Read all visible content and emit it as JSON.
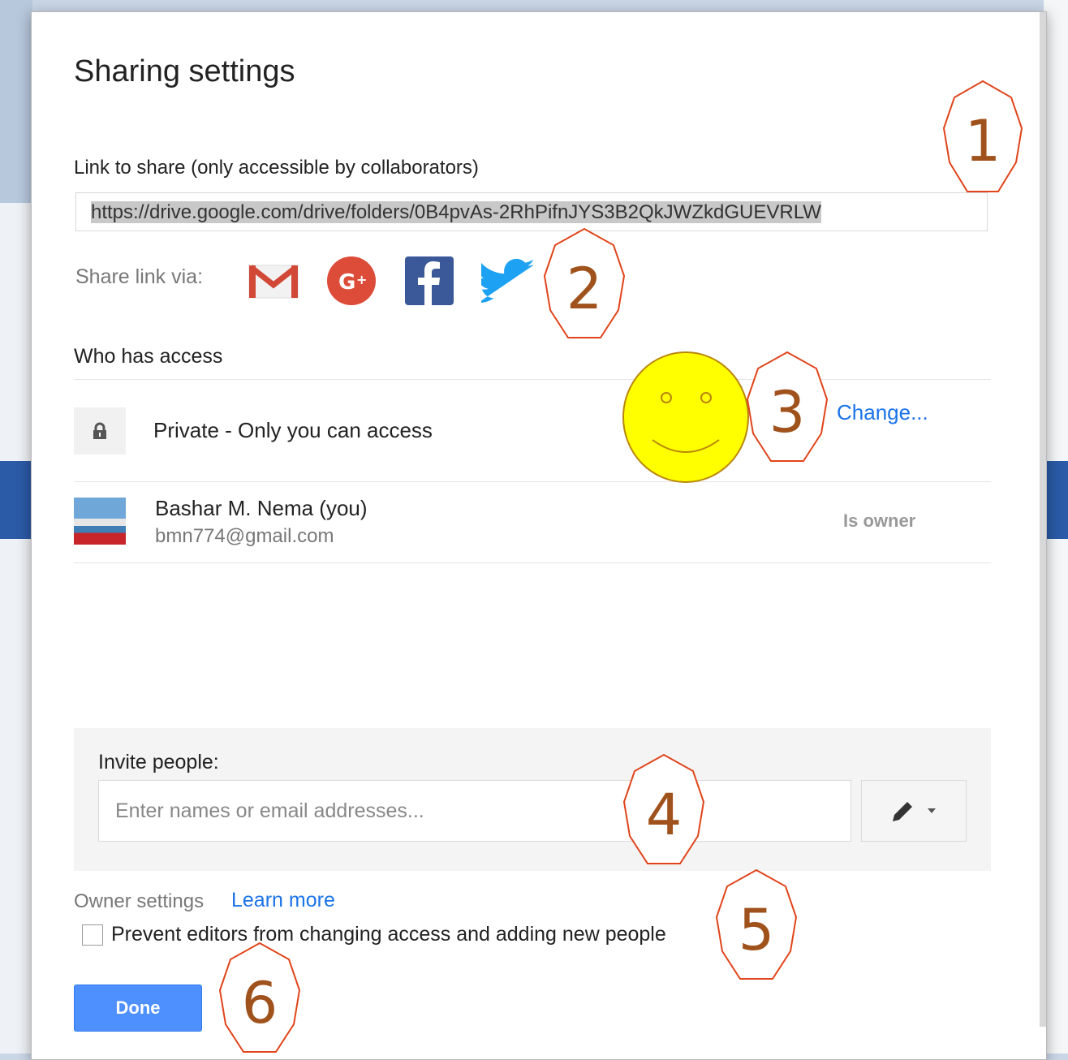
{
  "dialog": {
    "title": "Sharing settings",
    "link_label": "Link to share (only accessible by collaborators)",
    "link_value": "https://drive.google.com/drive/folders/0B4pvAs-2RhPifnJYS3B2QkJWZkdGUEVRLW",
    "share_via_label": "Share link via:",
    "share_icons": [
      "gmail-icon",
      "google-plus-icon",
      "facebook-icon",
      "twitter-icon"
    ],
    "who_has_access": "Who has access",
    "access": {
      "private_label": "Private - Only you can access",
      "change_link": "Change..."
    },
    "owner": {
      "name": "Bashar M. Nema (you)",
      "email": "bmn774@gmail.com",
      "role": "Is owner"
    },
    "invite": {
      "label": "Invite people:",
      "placeholder": "Enter names or email addresses..."
    },
    "owner_settings": {
      "label": "Owner settings",
      "learn_more": "Learn more",
      "prevent_label": "Prevent editors from changing access and adding new people",
      "prevent_checked": false
    },
    "done_label": "Done"
  },
  "callouts": [
    "1",
    "2",
    "3",
    "4",
    "5",
    "6"
  ],
  "colors": {
    "accent_blue": "#4d90fe",
    "link_blue": "#1a73e8",
    "callout_stroke": "#e0441a",
    "callout_text": "#a0521c",
    "smiley_fill": "#ffff00"
  }
}
